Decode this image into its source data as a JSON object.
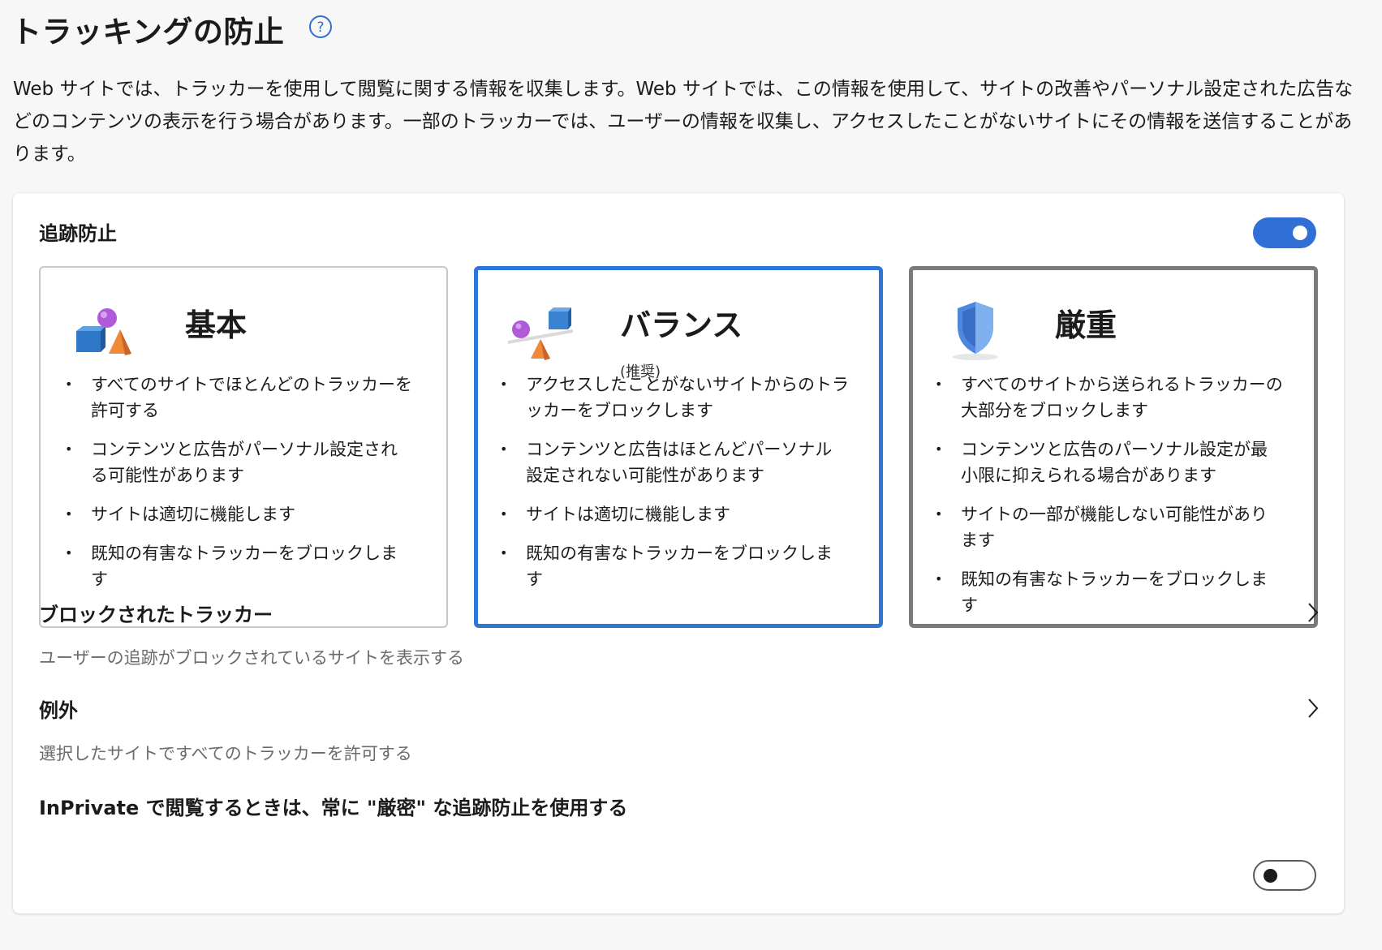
{
  "header": {
    "title": "トラッキングの防止",
    "help_icon": "question-circle-icon",
    "description": "Web サイトでは、トラッカーを使用して閲覧に関する情報を収集します。Web サイトでは、この情報を使用して、サイトの改善やパーソナル設定された広告などのコンテンツの表示を行う場合があります。一部のトラッカーでは、ユーザーの情報を収集し、アクセスしたことがないサイトにその情報を送信することがあります。"
  },
  "tracking": {
    "label": "追跡防止",
    "enabled": true,
    "accent_color": "#2f6fd6"
  },
  "cards": {
    "basic": {
      "title": "基本",
      "icon": "shapes-icon",
      "items": [
        "すべてのサイトでほとんどのトラッカーを許可する",
        "コンテンツと広告がパーソナル設定される可能性があります",
        "サイトは適切に機能します",
        "既知の有害なトラッカーをブロックします"
      ]
    },
    "balanced": {
      "title": "バランス",
      "subtitle": "(推奨)",
      "icon": "balance-scale-icon",
      "selected": true,
      "items": [
        "アクセスしたことがないサイトからのトラッカーをブロックします",
        "コンテンツと広告はほとんどパーソナル設定されない可能性があります",
        "サイトは適切に機能します",
        "既知の有害なトラッカーをブロックします"
      ]
    },
    "strict": {
      "title": "厳重",
      "icon": "shield-icon",
      "items": [
        "すべてのサイトから送られるトラッカーの大部分をブロックします",
        "コンテンツと広告のパーソナル設定が最小限に抑えられる場合があります",
        "サイトの一部が機能しない可能性があります",
        "既知の有害なトラッカーをブロックします"
      ]
    }
  },
  "rows": {
    "blocked": {
      "title": "ブロックされたトラッカー",
      "subtitle": "ユーザーの追跡がブロックされているサイトを表示する"
    },
    "exceptions": {
      "title": "例外",
      "subtitle": "選択したサイトですべてのトラッカーを許可する"
    },
    "inprivate": {
      "label": "InPrivate で閲覧するときは、常に \"厳密\" な追跡防止を使用する",
      "enabled": false
    }
  }
}
